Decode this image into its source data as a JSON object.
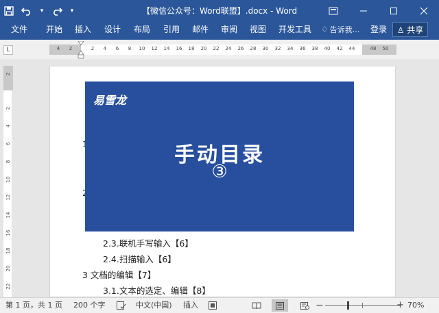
{
  "titlebar": {
    "document_title": "【微信公众号：Word联盟】.docx - Word",
    "icons": {
      "save": "save-icon",
      "undo": "undo-icon",
      "redo": "redo-icon",
      "customize": "customize-qat-icon",
      "ribbon_options": "ribbon-display-options-icon",
      "minimize": "minimize-icon",
      "maximize": "maximize-icon",
      "close": "close-icon"
    },
    "background": "#2b579a"
  },
  "ribbon": {
    "tabs": [
      {
        "label": "文件"
      },
      {
        "label": "开始"
      },
      {
        "label": "插入"
      },
      {
        "label": "设计"
      },
      {
        "label": "布局"
      },
      {
        "label": "引用"
      },
      {
        "label": "邮件"
      },
      {
        "label": "审阅"
      },
      {
        "label": "视图"
      },
      {
        "label": "开发工具"
      }
    ],
    "tell_me": "告诉我...",
    "login": "登录",
    "share": "共享"
  },
  "ruler": {
    "corner": "L",
    "ticks": [
      "4",
      "2",
      "2",
      "4",
      "6",
      "8",
      "10",
      "12",
      "14",
      "16",
      "18",
      "20",
      "22",
      "24",
      "26",
      "28",
      "30",
      "32",
      "34",
      "36",
      "38",
      "40",
      "42",
      "44",
      "48",
      "50"
    ],
    "vticks": [
      "2",
      "2",
      "4",
      "6",
      "8",
      "10",
      "12",
      "14",
      "16",
      "18",
      "20",
      "22"
    ]
  },
  "document": {
    "lines": [
      "2.3.联机手写输入【6】",
      "2.4.扫描输入【6】",
      "3  文档的编辑【7】",
      "3.1.文本的选定、编辑【8】"
    ],
    "partial_1": "1",
    "partial_2": "2"
  },
  "banner": {
    "brand": "易雪龙",
    "heading": "手动目录",
    "number": "③",
    "background": "#284f9e"
  },
  "statusbar": {
    "page": "第 1 页，共 1 页",
    "words": "200 个字",
    "language": "中文(中国)",
    "insert_mode": "插入",
    "zoom": "70%"
  }
}
